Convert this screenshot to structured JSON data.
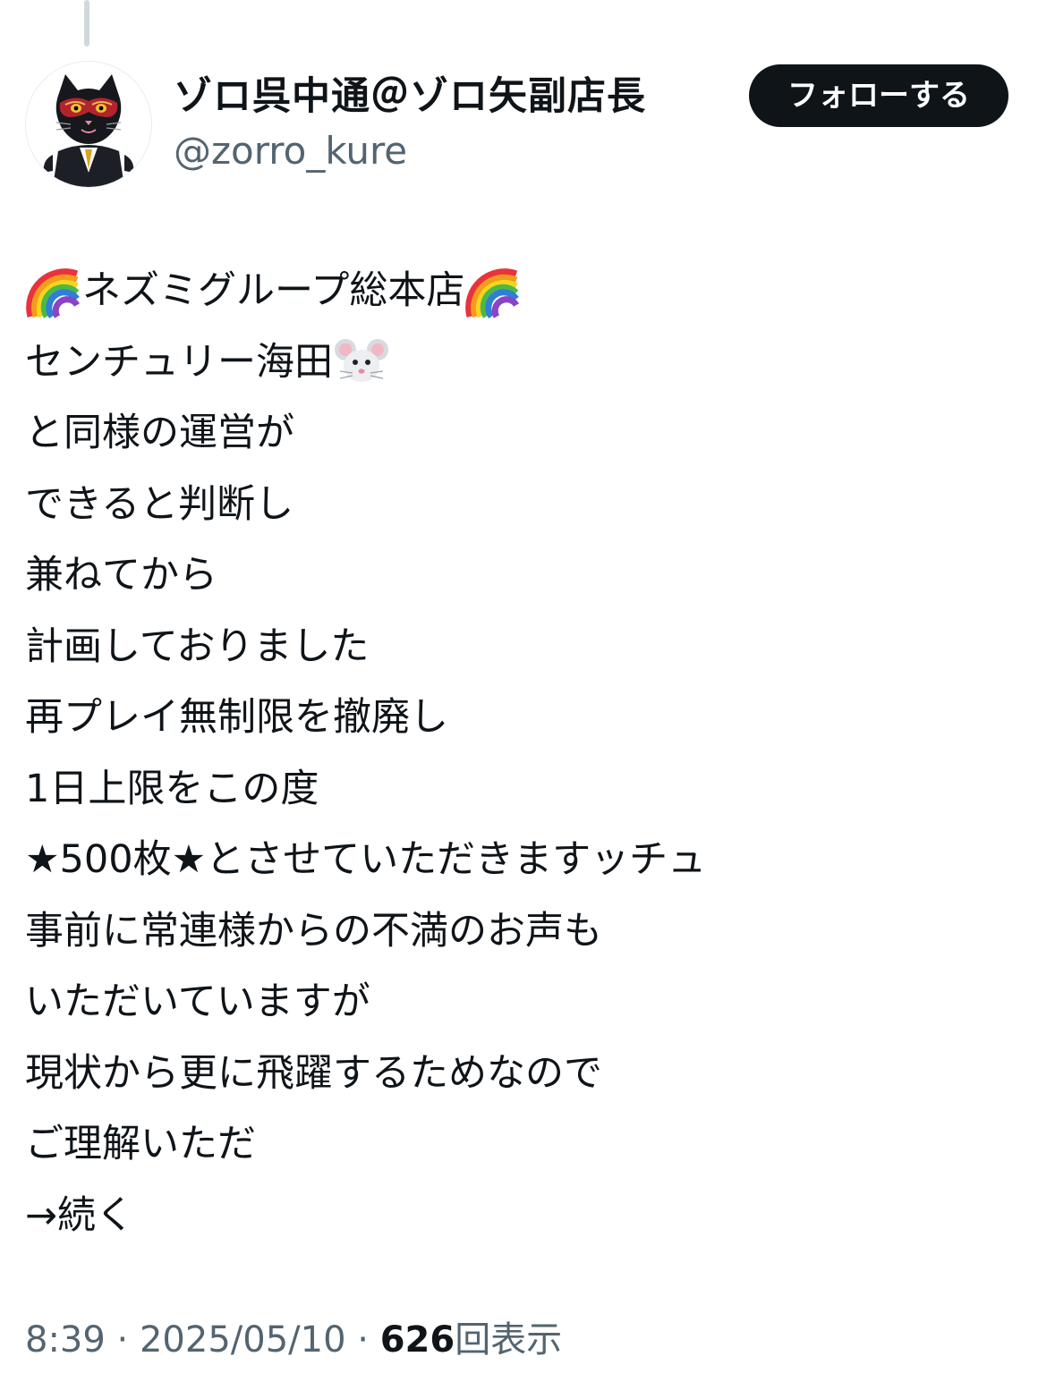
{
  "author": {
    "display_name": "ゾロ呉中通＠ゾロ矢副店長",
    "handle": "@zorro_kure",
    "avatar_icon": "black-cat-in-suit-masked-avatar"
  },
  "follow_button": {
    "label": "フォローする"
  },
  "tweet": {
    "line1": {
      "leading_emoji": "rainbow-emoji",
      "text": "ネズミグループ総本店",
      "trailing_emoji": "rainbow-emoji"
    },
    "line2": {
      "text": "センチュリー海田",
      "trailing_emoji": "mouse-face-emoji"
    },
    "lines": [
      "と同様の運営が",
      "できると判断し",
      "兼ねてから",
      "計画しておりました",
      "再プレイ無制限を撤廃し",
      "1日上限をこの度",
      "★500枚★とさせていただきますッチュ",
      "事前に常連様からの不満のお声も",
      "いただいていますが",
      "現状から更に飛躍するためなので",
      "ご理解いただ",
      "→続く"
    ]
  },
  "meta": {
    "time": "8:39",
    "separator": " · ",
    "date": "2025/05/10",
    "views_count": "626",
    "views_label": "回表示"
  },
  "colors": {
    "text_primary": "#0f1419",
    "text_secondary": "#536471",
    "follow_button_bg": "#0f1419",
    "follow_button_text": "#ffffff",
    "thread_line": "#cfd9de"
  }
}
